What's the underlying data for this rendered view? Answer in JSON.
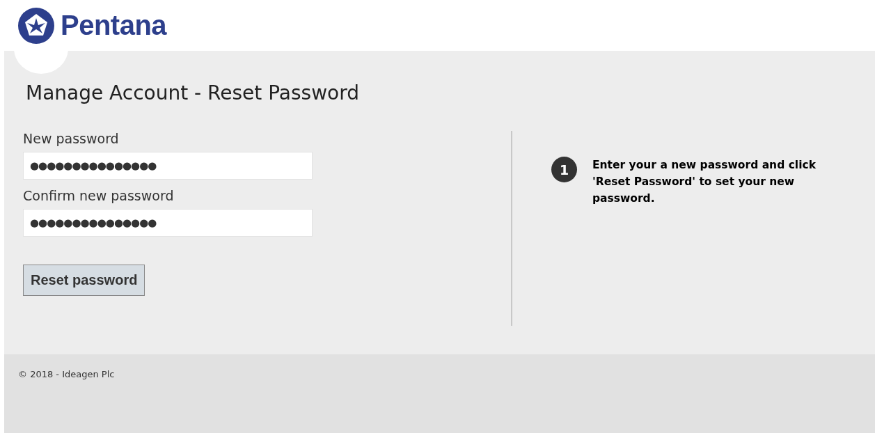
{
  "header": {
    "brand": "Pentana"
  },
  "page_title": "Manage Account - Reset Password",
  "form": {
    "fields": [
      {
        "label": "New password",
        "value": "●●●●●●●●●●●●●●●"
      },
      {
        "label": "Confirm new password",
        "value": "●●●●●●●●●●●●●●●"
      }
    ],
    "submit": "Reset password"
  },
  "help": {
    "steps": [
      {
        "number": "1",
        "text": "Enter your a new password and click 'Reset Password' to set your new password."
      }
    ]
  },
  "footer": {
    "copyright": "© 2018 - Ideagen Plc"
  }
}
